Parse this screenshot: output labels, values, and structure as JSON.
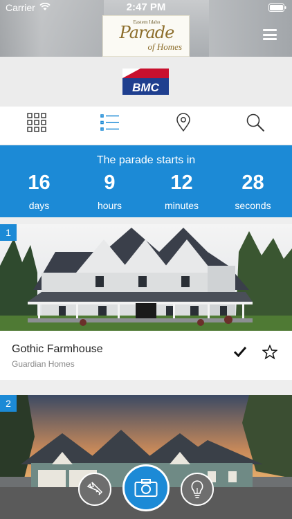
{
  "status": {
    "carrier": "Carrier",
    "time": "2:47 PM"
  },
  "logo": {
    "small": "Eastern Idaho",
    "main": "Parade",
    "sub": "of Homes"
  },
  "sponsor": {
    "name": "BMC"
  },
  "tabs": [
    {
      "name": "grid-view",
      "icon": "grid-icon"
    },
    {
      "name": "list-view",
      "icon": "list-icon",
      "active": true
    },
    {
      "name": "map-view",
      "icon": "map-pin-icon"
    },
    {
      "name": "search",
      "icon": "search-icon"
    }
  ],
  "countdown": {
    "title": "The parade starts in",
    "units": [
      {
        "value": "16",
        "label": "days"
      },
      {
        "value": "9",
        "label": "hours"
      },
      {
        "value": "12",
        "label": "minutes"
      },
      {
        "value": "28",
        "label": "seconds"
      }
    ]
  },
  "listings": [
    {
      "number": "1",
      "title": "Gothic Farmhouse",
      "builder": "Guardian Homes",
      "visited": true,
      "favorite": false
    },
    {
      "number": "2"
    }
  ],
  "actions": [
    {
      "name": "ticket-button",
      "icon": "ticket-icon"
    },
    {
      "name": "camera-button",
      "icon": "camera-icon"
    },
    {
      "name": "tips-button",
      "icon": "lightbulb-icon"
    }
  ],
  "colors": {
    "accent": "#1c8ad6",
    "actionbar": "#5a5a5a",
    "bmc_red": "#c8102e",
    "bmc_blue": "#1f3f8f"
  }
}
